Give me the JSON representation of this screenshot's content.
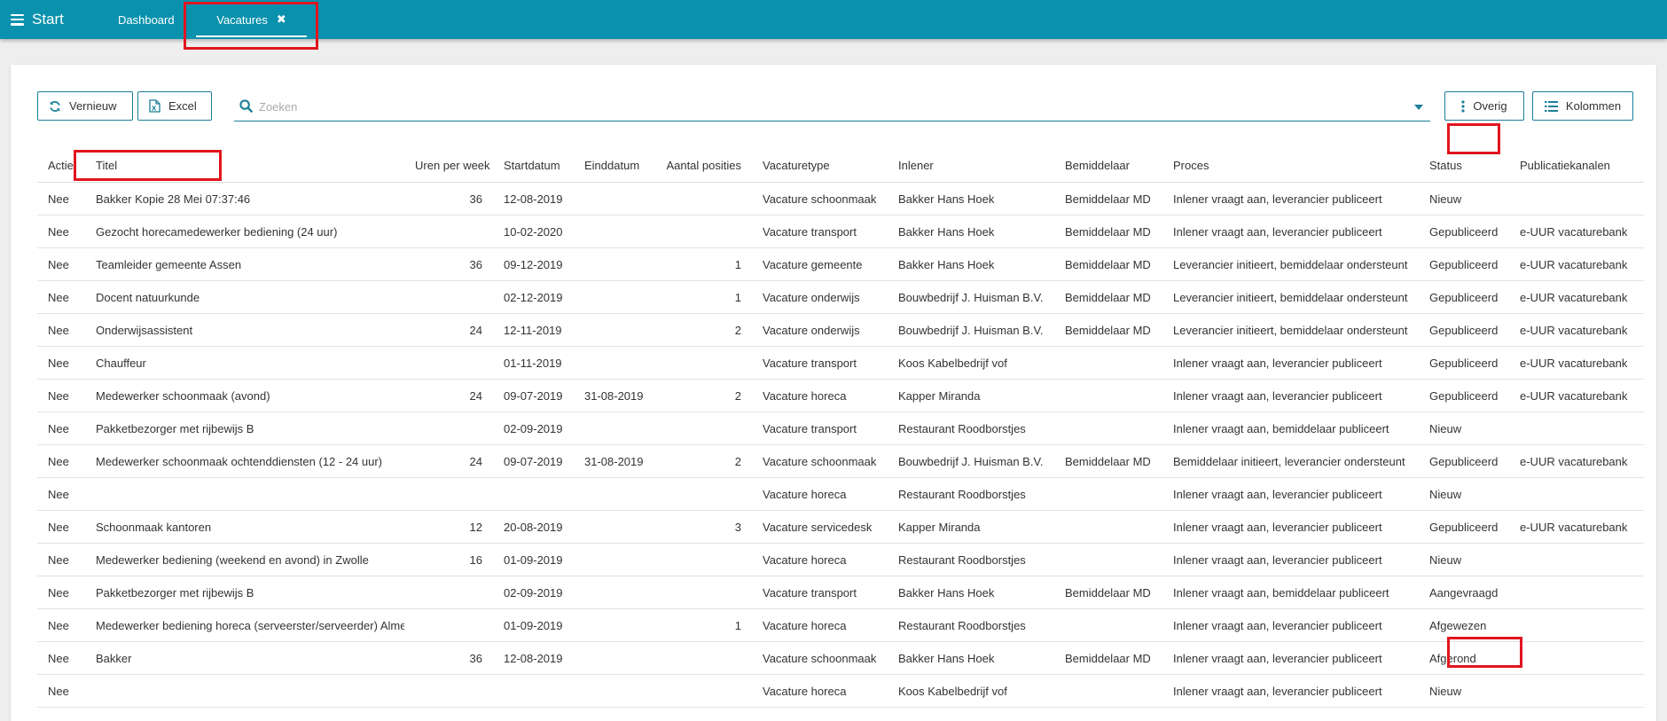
{
  "topbar": {
    "start_label": "Start",
    "tabs": [
      {
        "label": "Dashboard"
      },
      {
        "label": "Vacatures",
        "close_icon": "✖"
      }
    ]
  },
  "toolbar": {
    "refresh_label": "Vernieuw",
    "excel_label": "Excel",
    "search_placeholder": "Zoeken",
    "search_value": "",
    "overig_label": "Overig",
    "kolommen_label": "Kolommen"
  },
  "icons": {
    "refresh": "refresh-icon",
    "excel": "excel-file-icon",
    "search": "search-icon",
    "more": "more-vertical-icon",
    "columns": "list-icon"
  },
  "colors": {
    "brand": "#0a91ad",
    "accent": "#1b7f98",
    "highlight": "#e0151f"
  },
  "table": {
    "columns": [
      "Actie",
      "Titel",
      "Uren per week",
      "Startdatum",
      "Einddatum",
      "Aantal posities",
      "Vacaturetype",
      "Inlener",
      "Bemiddelaar",
      "Proces",
      "Status",
      "Publicatiekanalen"
    ],
    "rows": [
      [
        "Nee",
        "Bakker Kopie 28 Mei 07:37:46",
        "36",
        "12-08-2019",
        "",
        "",
        "Vacature schoonmaak",
        "Bakker Hans Hoek",
        "Bemiddelaar MD",
        "Inlener vraagt aan, leverancier publiceert",
        "Nieuw",
        ""
      ],
      [
        "Nee",
        "Gezocht horecamedewerker bediening (24 uur)",
        "",
        "10-02-2020",
        "",
        "",
        "Vacature transport",
        "Bakker Hans Hoek",
        "Bemiddelaar MD",
        "Inlener vraagt aan, leverancier publiceert",
        "Gepubliceerd",
        "e-UUR vacaturebank"
      ],
      [
        "Nee",
        "Teamleider gemeente Assen",
        "36",
        "09-12-2019",
        "",
        "1",
        "Vacature gemeente",
        "Bakker Hans Hoek",
        "Bemiddelaar MD",
        "Leverancier initieert, bemiddelaar ondersteunt",
        "Gepubliceerd",
        "e-UUR vacaturebank"
      ],
      [
        "Nee",
        "Docent natuurkunde",
        "",
        "02-12-2019",
        "",
        "1",
        "Vacature onderwijs",
        "Bouwbedrijf J. Huisman B.V.",
        "Bemiddelaar MD",
        "Leverancier initieert, bemiddelaar ondersteunt",
        "Gepubliceerd",
        "e-UUR vacaturebank"
      ],
      [
        "Nee",
        "Onderwijsassistent",
        "24",
        "12-11-2019",
        "",
        "2",
        "Vacature onderwijs",
        "Bouwbedrijf J. Huisman B.V.",
        "Bemiddelaar MD",
        "Leverancier initieert, bemiddelaar ondersteunt",
        "Gepubliceerd",
        "e-UUR vacaturebank"
      ],
      [
        "Nee",
        "Chauffeur",
        "",
        "01-11-2019",
        "",
        "",
        "Vacature transport",
        "Koos Kabelbedrijf vof",
        "",
        "Inlener vraagt aan, leverancier publiceert",
        "Gepubliceerd",
        "e-UUR vacaturebank"
      ],
      [
        "Nee",
        "Medewerker schoonmaak (avond)",
        "24",
        "09-07-2019",
        "31-08-2019",
        "2",
        "Vacature horeca",
        "Kapper Miranda",
        "",
        "Inlener vraagt aan, leverancier publiceert",
        "Gepubliceerd",
        "e-UUR vacaturebank"
      ],
      [
        "Nee",
        "Pakketbezorger met rijbewijs B",
        "",
        "02-09-2019",
        "",
        "",
        "Vacature transport",
        "Restaurant Roodborstjes",
        "",
        "Inlener vraagt aan, bemiddelaar publiceert",
        "Nieuw",
        ""
      ],
      [
        "Nee",
        "Medewerker schoonmaak ochtenddiensten (12 - 24 uur)",
        "24",
        "09-07-2019",
        "31-08-2019",
        "2",
        "Vacature schoonmaak",
        "Bouwbedrijf J. Huisman B.V.",
        "Bemiddelaar MD",
        "Bemiddelaar initieert, leverancier ondersteunt",
        "Gepubliceerd",
        "e-UUR vacaturebank"
      ],
      [
        "Nee",
        "",
        "",
        "",
        "",
        "",
        "Vacature horeca",
        "Restaurant Roodborstjes",
        "",
        "Inlener vraagt aan, leverancier publiceert",
        "Nieuw",
        ""
      ],
      [
        "Nee",
        "Schoonmaak kantoren",
        "12",
        "20-08-2019",
        "",
        "3",
        "Vacature servicedesk",
        "Kapper Miranda",
        "",
        "Inlener vraagt aan, leverancier publiceert",
        "Gepubliceerd",
        "e-UUR vacaturebank"
      ],
      [
        "Nee",
        "Medewerker bediening (weekend en avond) in Zwolle",
        "16",
        "01-09-2019",
        "",
        "",
        "Vacature horeca",
        "Restaurant Roodborstjes",
        "",
        "Inlener vraagt aan, leverancier publiceert",
        "Nieuw",
        ""
      ],
      [
        "Nee",
        "Pakketbezorger met rijbewijs B",
        "",
        "02-09-2019",
        "",
        "",
        "Vacature transport",
        "Bakker Hans Hoek",
        "Bemiddelaar MD",
        "Inlener vraagt aan, bemiddelaar publiceert",
        "Aangevraagd",
        ""
      ],
      [
        "Nee",
        "Medewerker bediening horeca (serveerster/serveerder) Almelo",
        "",
        "01-09-2019",
        "",
        "1",
        "Vacature horeca",
        "Restaurant Roodborstjes",
        "",
        "Inlener vraagt aan, leverancier publiceert",
        "Afgewezen",
        ""
      ],
      [
        "Nee",
        "Bakker",
        "36",
        "12-08-2019",
        "",
        "",
        "Vacature schoonmaak",
        "Bakker Hans Hoek",
        "Bemiddelaar MD",
        "Inlener vraagt aan, leverancier publiceert",
        "Afgerond",
        ""
      ],
      [
        "Nee",
        "",
        "",
        "",
        "",
        "",
        "Vacature horeca",
        "Koos Kabelbedrijf vof",
        "",
        "Inlener vraagt aan, leverancier publiceert",
        "Nieuw",
        ""
      ]
    ]
  }
}
